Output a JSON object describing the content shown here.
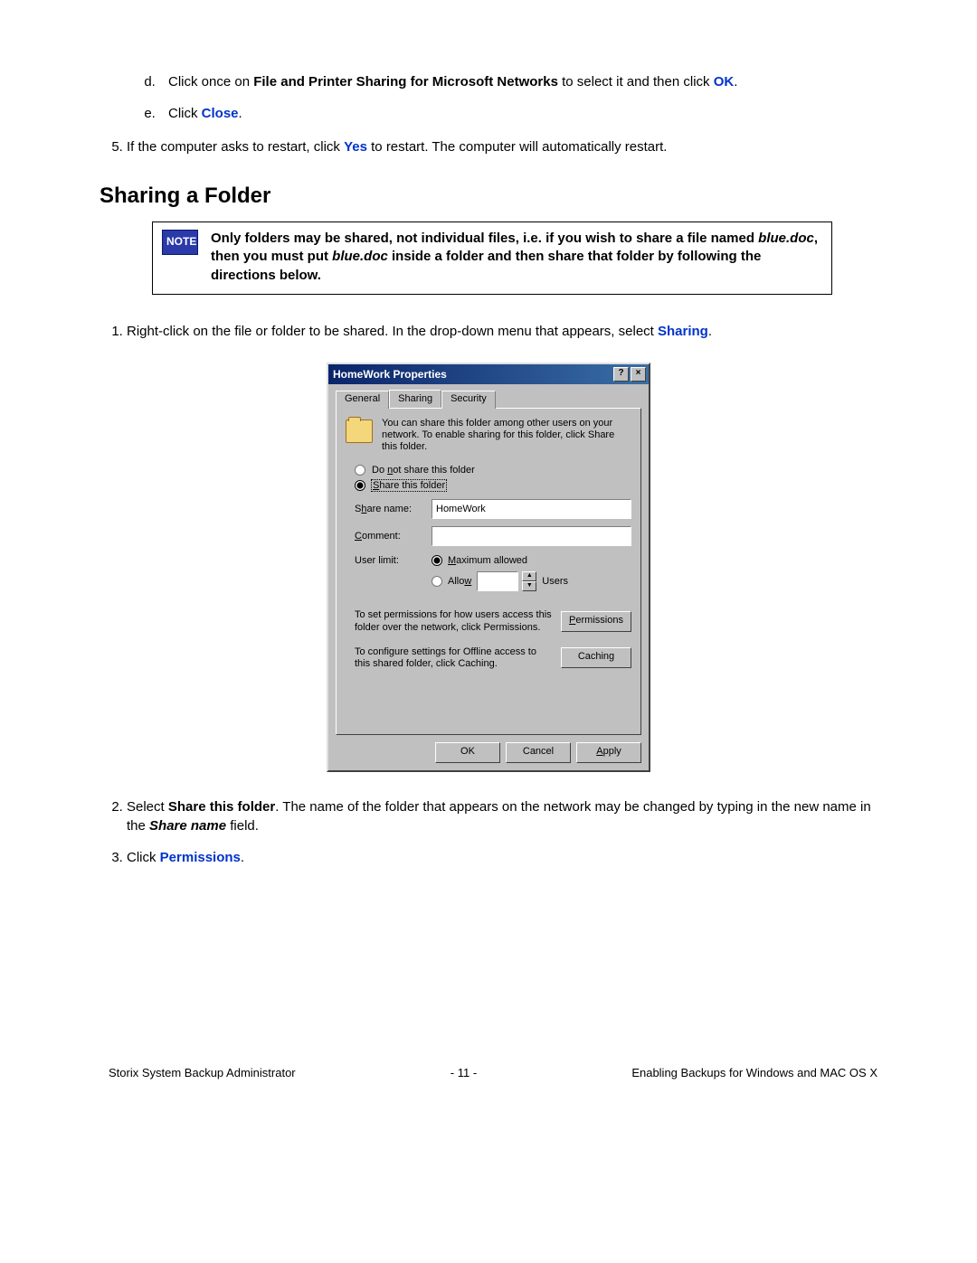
{
  "steps": {
    "d_prefix": "Click once on ",
    "d_bold": "File and Printer Sharing for Microsoft Networks",
    "d_mid": " to select it and then click ",
    "d_ok": "OK",
    "d_period": ".",
    "e_prefix": "Click ",
    "e_close": "Close",
    "e_period": ".",
    "five_prefix": "If the computer asks to restart, click ",
    "five_yes": "Yes",
    "five_suffix": " to restart. The computer will automatically restart."
  },
  "heading": "Sharing a Folder",
  "note": {
    "part1": "Only folders may be shared, not individual files, i.e. if you wish to share a file named ",
    "blue1": "blue.doc",
    "part2": ", then you must put ",
    "blue2": "blue.doc",
    "part3": " inside a folder and then share that folder by following the directions below."
  },
  "share_steps": {
    "one_prefix": "Right-click on the file or folder to be shared. In the drop-down menu that appears, select ",
    "one_sharing": "Sharing",
    "one_period": ".",
    "two_a": "Select ",
    "two_share": "Share this folder",
    "two_b": ". The name of the folder that appears on the network may be changed by typing in the new name in the ",
    "two_sharename": "Share name",
    "two_c": " field.",
    "three_a": "Click ",
    "three_perm": "Permissions",
    "three_b": "."
  },
  "dialog": {
    "title": "HomeWork Properties",
    "help_btn": "?",
    "close_btn": "×",
    "tabs": {
      "general": "General",
      "sharing": "Sharing",
      "security": "Security"
    },
    "share_desc": "You can share this folder among other users on your network.  To enable sharing for this folder, click Share this folder.",
    "radio_no_share": "Do not share this folder",
    "radio_share": "Share this folder",
    "share_name_label": "Share name:",
    "share_name_value": "HomeWork",
    "comment_label": "Comment:",
    "comment_value": "",
    "user_limit_label": "User limit:",
    "max_allowed": "Maximum allowed",
    "allow_label": "Allow",
    "users_label": "Users",
    "perm_text": "To set permissions for how users access this folder over the network, click Permissions.",
    "perm_btn": "Permissions",
    "cache_text": "To configure settings for Offline access to this shared folder, click Caching.",
    "cache_btn": "Caching",
    "ok_btn": "OK",
    "cancel_btn": "Cancel",
    "apply_btn": "Apply"
  },
  "footer": {
    "left": "Storix System Backup Administrator",
    "center": "- 11 -",
    "right": "Enabling Backups for Windows and MAC OS X"
  }
}
